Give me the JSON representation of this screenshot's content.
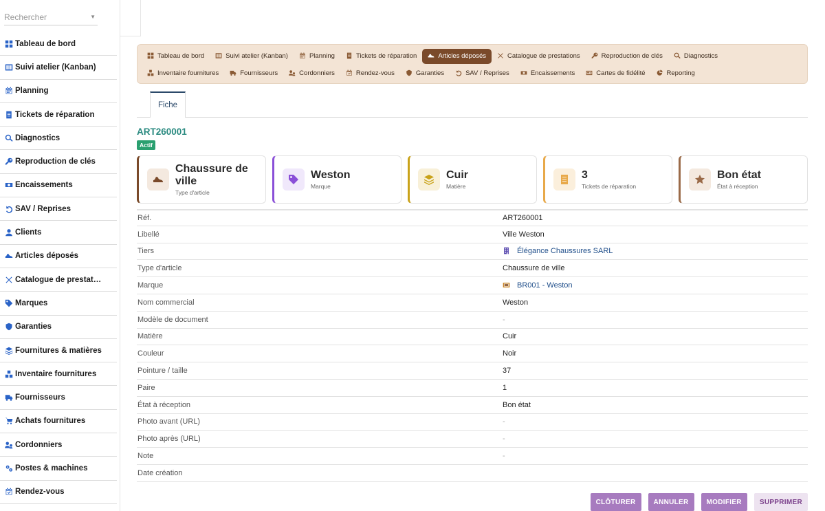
{
  "sidebar": {
    "search_placeholder": "Rechercher",
    "items": [
      {
        "label": "Tableau de bord",
        "icon": "dashboard-icon"
      },
      {
        "label": "Suivi atelier (Kanban)",
        "icon": "kanban-icon"
      },
      {
        "label": "Planning",
        "icon": "calendar-icon"
      },
      {
        "label": "Tickets de réparation",
        "icon": "ticket-icon"
      },
      {
        "label": "Diagnostics",
        "icon": "search-icon"
      },
      {
        "label": "Reproduction de clés",
        "icon": "key-icon"
      },
      {
        "label": "Encaissements",
        "icon": "money-icon"
      },
      {
        "label": "SAV / Reprises",
        "icon": "undo-icon"
      },
      {
        "label": "Clients",
        "icon": "user-icon"
      },
      {
        "label": "Articles déposés",
        "icon": "shoe-icon"
      },
      {
        "label": "Catalogue de prestat…",
        "icon": "tools-icon"
      },
      {
        "label": "Marques",
        "icon": "tag-icon"
      },
      {
        "label": "Garanties",
        "icon": "shield-icon"
      },
      {
        "label": "Fournitures & matières",
        "icon": "layers-icon"
      },
      {
        "label": "Inventaire fournitures",
        "icon": "boxes-icon"
      },
      {
        "label": "Fournisseurs",
        "icon": "truck-icon"
      },
      {
        "label": "Achats fournitures",
        "icon": "cart-icon"
      },
      {
        "label": "Cordonniers",
        "icon": "workers-icon"
      },
      {
        "label": "Postes & machines",
        "icon": "gears-icon"
      },
      {
        "label": "Rendez-vous",
        "icon": "calendar-check-icon"
      }
    ]
  },
  "module_nav": {
    "row1": [
      {
        "label": "Tableau de bord",
        "icon": "dashboard-icon",
        "active": false
      },
      {
        "label": "Suivi atelier (Kanban)",
        "icon": "kanban-icon",
        "active": false
      },
      {
        "label": "Planning",
        "icon": "calendar-icon",
        "active": false
      },
      {
        "label": "Tickets de réparation",
        "icon": "ticket-icon",
        "active": false
      },
      {
        "label": "Articles déposés",
        "icon": "shoe-icon",
        "active": true
      },
      {
        "label": "Catalogue de prestations",
        "icon": "tools-icon",
        "active": false
      },
      {
        "label": "Reproduction de clés",
        "icon": "key-icon",
        "active": false
      },
      {
        "label": "Diagnostics",
        "icon": "search-icon",
        "active": false
      }
    ],
    "row2": [
      {
        "label": "Inventaire fournitures",
        "icon": "boxes-icon",
        "active": false
      },
      {
        "label": "Fournisseurs",
        "icon": "truck-icon",
        "active": false
      },
      {
        "label": "Cordonniers",
        "icon": "workers-icon",
        "active": false
      },
      {
        "label": "Rendez-vous",
        "icon": "calendar-check-icon",
        "active": false
      },
      {
        "label": "Garanties",
        "icon": "shield-icon",
        "active": false
      },
      {
        "label": "SAV / Reprises",
        "icon": "undo-icon",
        "active": false
      },
      {
        "label": "Encaissements",
        "icon": "money-icon",
        "active": false
      },
      {
        "label": "Cartes de fidélité",
        "icon": "card-icon",
        "active": false
      },
      {
        "label": "Reporting",
        "icon": "pie-icon",
        "active": false
      }
    ]
  },
  "tabs": [
    {
      "label": "Fiche",
      "active": true
    }
  ],
  "record": {
    "ref": "ART260001",
    "status": "Actif"
  },
  "cards": [
    {
      "value": "Chaussure de ville",
      "label": "Type d'article",
      "icon": "shoe-icon",
      "color": "#7a4a2a",
      "bg": "#f4e9df"
    },
    {
      "value": "Weston",
      "label": "Marque",
      "icon": "tag-icon",
      "color": "#8a4fd8",
      "bg": "#f0e8fb"
    },
    {
      "value": "Cuir",
      "label": "Matière",
      "icon": "layers-icon",
      "color": "#c9a21a",
      "bg": "#f8f0d8"
    },
    {
      "value": "3",
      "label": "Tickets de réparation",
      "icon": "ticket-icon",
      "color": "#e8a94a",
      "bg": "#fbefdc"
    },
    {
      "value": "Bon état",
      "label": "État à réception",
      "icon": "star-icon",
      "color": "#9a6a48",
      "bg": "#f4e9df"
    }
  ],
  "details": [
    {
      "label": "Réf.",
      "value": "ART260001"
    },
    {
      "label": "Libellé",
      "value": "Ville Weston"
    },
    {
      "label": "Tiers",
      "value": "Élégance Chaussures SARL",
      "link": true,
      "icon": "building-icon"
    },
    {
      "label": "Type d'article",
      "value": "Chaussure de ville"
    },
    {
      "label": "Marque",
      "value": "BR001 - Weston",
      "link": true,
      "icon": "brand-icon"
    },
    {
      "label": "Nom commercial",
      "value": "Weston"
    },
    {
      "label": "Modèle de document",
      "value": "-",
      "empty": true
    },
    {
      "label": "Matière",
      "value": "Cuir"
    },
    {
      "label": "Couleur",
      "value": "Noir"
    },
    {
      "label": "Pointure / taille",
      "value": "37"
    },
    {
      "label": "Paire",
      "value": "1"
    },
    {
      "label": "État à réception",
      "value": "Bon état"
    },
    {
      "label": "Photo avant (URL)",
      "value": "-",
      "empty": true
    },
    {
      "label": "Photo après (URL)",
      "value": "-",
      "empty": true
    },
    {
      "label": "Note",
      "value": "-",
      "empty": true
    },
    {
      "label": "Date création",
      "value": ""
    }
  ],
  "actions": {
    "close": "CLÔTURER",
    "cancel": "ANNULER",
    "edit": "MODIFIER",
    "delete": "SUPPRIMER"
  }
}
